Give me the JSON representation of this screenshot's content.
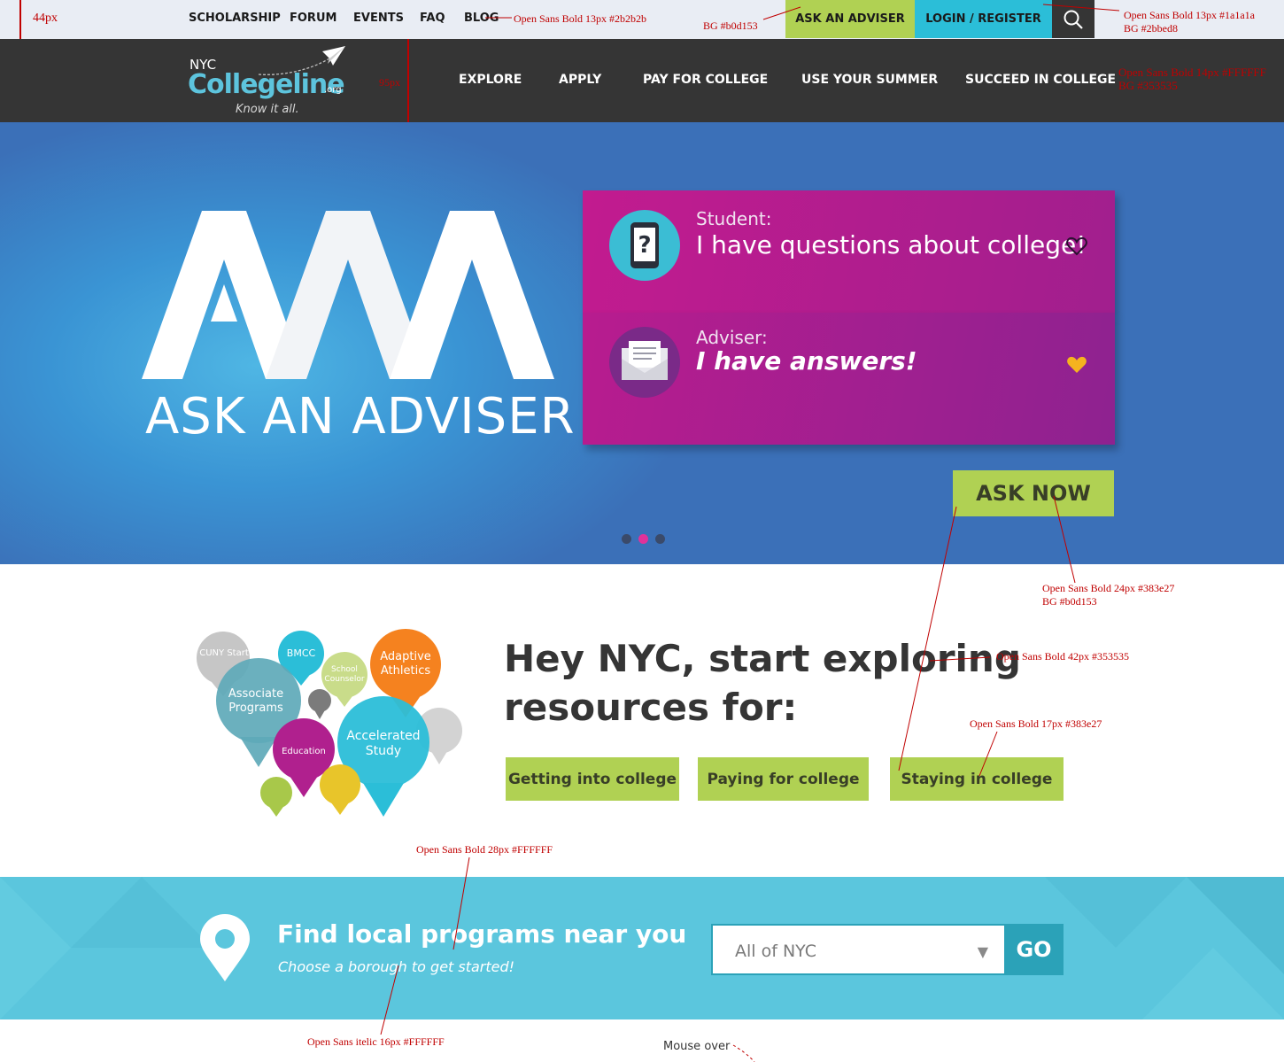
{
  "utility_bar": {
    "links": [
      "SCHOLARSHIP",
      "FORUM",
      "EVENTS",
      "FAQ",
      "BLOG"
    ],
    "ask_adviser": "ASK AN ADVISER",
    "login": "LOGIN / REGISTER",
    "search_icon": "search-icon"
  },
  "logo": {
    "nyc": "NYC",
    "name": "Collegeline",
    "suffix": ".org",
    "tagline": "Know it all."
  },
  "nav": {
    "items": [
      "EXPLORE",
      "APPLY",
      "PAY FOR COLLEGE",
      "USE YOUR SUMMER",
      "SUCCEED IN COLLEGE"
    ]
  },
  "hero": {
    "heading": "ASK AN ADVISER",
    "student_role": "Student:",
    "student_message": "I have questions about college!",
    "adviser_role": "Adviser:",
    "adviser_message": "I have answers!",
    "cta": "ASK NOW",
    "slides": 3,
    "active_slide": 2
  },
  "bubbles": {
    "labels": [
      "CUNY Start",
      "BMCC",
      "School Counselor",
      "Adaptive Athletics",
      "Associate Programs",
      "Education",
      "Accelerated Study"
    ]
  },
  "explore": {
    "title": "Hey NYC, start exploring resources for:",
    "buttons": [
      "Getting into college",
      "Paying for college",
      "Staying in college"
    ]
  },
  "find_local": {
    "title": "Find local programs near you",
    "subtitle": "Choose a borough to get started!",
    "select_value": "All of NYC",
    "go": "GO",
    "pin_icon": "location-pin-icon"
  },
  "annotations": {
    "height_44": "44px",
    "height_95": "95px",
    "util_font": "Open Sans Bold 13px #2b2b2b",
    "ask_bg": "BG #b0d153",
    "login_font": "Open Sans Bold 13px #1a1a1a",
    "login_bg": "BG #2bbed8",
    "nav_font": "Open Sans Bold 14px #FFFFFF",
    "nav_bg": "BG #353535",
    "asknow_font": "Open Sans Bold 24px #383e27",
    "asknow_bg": "BG #b0d153",
    "title_font": "Open Sans Bold 42px #353535",
    "btn_font": "Open Sans Bold 17px #383e27",
    "find_font": "Open Sans Bold 28px #FFFFFF",
    "sub_font": "Open Sans itelic 16px #FFFFFF",
    "mouse_over": "Mouse over"
  },
  "colors": {
    "green": "#b0d153",
    "cyan": "#2bbed8",
    "dark": "#353535",
    "magenta": "#b0208e",
    "hero_blue": "#3b70b8",
    "find_bg": "#5bc6dd"
  }
}
